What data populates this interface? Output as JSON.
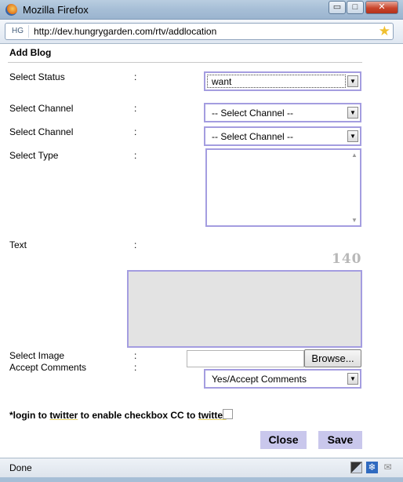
{
  "window": {
    "title": "Mozilla Firefox",
    "min_glyph": "▭",
    "max_glyph": "□",
    "close_glyph": "✕"
  },
  "addressbar": {
    "site_badge": "HG",
    "url": "http://dev.hungrygarden.com/rtv/addlocation",
    "star_glyph": "★"
  },
  "form": {
    "heading": "Add Blog",
    "colon": ":",
    "fields": {
      "status": {
        "label": "Select Status",
        "value": "want"
      },
      "channel1": {
        "label": "Select Channel",
        "value": "-- Select Channel --"
      },
      "channel2": {
        "label": "Select Channel",
        "value": "-- Select Channel --"
      },
      "type": {
        "label": "Select Type"
      },
      "text": {
        "label": "Text",
        "counter": "140"
      },
      "image": {
        "label": "Select Image",
        "browse_label": "Browse..."
      },
      "comments": {
        "label": "Accept Comments",
        "value": "Yes/Accept Comments"
      }
    },
    "note": {
      "p1": "*login to ",
      "p2": "twitter",
      "p3": " to enable checkbox CC to ",
      "p4": "twitter"
    },
    "buttons": {
      "close": "Close",
      "save": "Save"
    },
    "arrow_glyph": "▼"
  },
  "statusbar": {
    "text": "Done"
  }
}
